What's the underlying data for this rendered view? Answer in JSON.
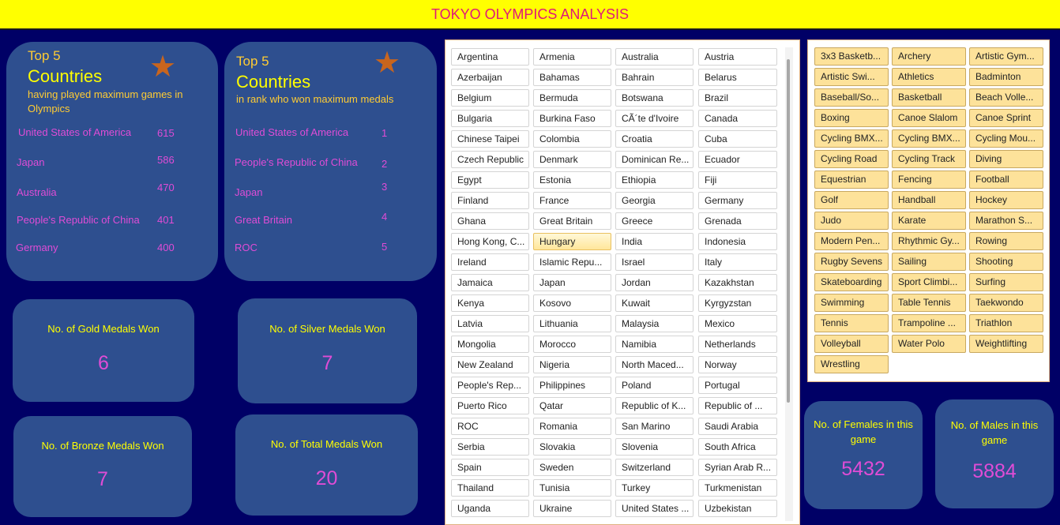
{
  "header": {
    "title": "TOKYO OLYMPICS ANALYSIS"
  },
  "colors": {
    "background": "#000066",
    "header": "#ffff00",
    "card": "#2e4f8f",
    "title_text": "#e0187a",
    "accent_pink": "#e04cd6",
    "accent_yellow": "#ffff00"
  },
  "games_card": {
    "top5": "Top 5",
    "title": "Countries",
    "subtitle": "having played maximum games in Olympics",
    "icon": "star-icon",
    "rows": [
      {
        "name": "United States of America",
        "value": "615"
      },
      {
        "name": "Japan",
        "value": "586"
      },
      {
        "name": "Australia",
        "value": "470"
      },
      {
        "name": "People's Republic of China",
        "value": "401"
      },
      {
        "name": "Germany",
        "value": "400"
      }
    ]
  },
  "medals_card": {
    "top5": "Top 5",
    "title": "Countries",
    "subtitle": "in rank who won maximum medals",
    "icon": "star-icon",
    "rows": [
      {
        "name": "United States of America",
        "value": "1"
      },
      {
        "name": "People's Republic of China",
        "value": "2"
      },
      {
        "name": "Japan",
        "value": "3"
      },
      {
        "name": "Great Britain",
        "value": "4"
      },
      {
        "name": "ROC",
        "value": "5"
      }
    ]
  },
  "stats": {
    "gold": {
      "label": "No. of  Gold Medals Won",
      "value": "6"
    },
    "silver": {
      "label": "No. of Silver Medals Won",
      "value": "7"
    },
    "bronze": {
      "label": "No. of Bronze Medals Won",
      "value": "7"
    },
    "total": {
      "label": "No. of Total Medals Won",
      "value": "20"
    },
    "females": {
      "label": "No. of Females in this game",
      "value": "5432"
    },
    "males": {
      "label": "No. of Males in this game",
      "value": "5884"
    }
  },
  "countries_slicer": {
    "selected": "Hungary",
    "items": [
      "Argentina",
      "Armenia",
      "Australia",
      "Austria",
      "Azerbaijan",
      "Bahamas",
      "Bahrain",
      "Belarus",
      "Belgium",
      "Bermuda",
      "Botswana",
      "Brazil",
      "Bulgaria",
      "Burkina Faso",
      "CÃ´te d'Ivoire",
      "Canada",
      "Chinese Taipei",
      "Colombia",
      "Croatia",
      "Cuba",
      "Czech Republic",
      "Denmark",
      "Dominican Re...",
      "Ecuador",
      "Egypt",
      "Estonia",
      "Ethiopia",
      "Fiji",
      "Finland",
      "France",
      "Georgia",
      "Germany",
      "Ghana",
      "Great Britain",
      "Greece",
      "Grenada",
      "Hong Kong, C...",
      "Hungary",
      "India",
      "Indonesia",
      "Ireland",
      "Islamic Repu...",
      "Israel",
      "Italy",
      "Jamaica",
      "Japan",
      "Jordan",
      "Kazakhstan",
      "Kenya",
      "Kosovo",
      "Kuwait",
      "Kyrgyzstan",
      "Latvia",
      "Lithuania",
      "Malaysia",
      "Mexico",
      "Mongolia",
      "Morocco",
      "Namibia",
      "Netherlands",
      "New Zealand",
      "Nigeria",
      "North Maced...",
      "Norway",
      "People's Rep...",
      "Philippines",
      "Poland",
      "Portugal",
      "Puerto Rico",
      "Qatar",
      "Republic of K...",
      "Republic of ...",
      "ROC",
      "Romania",
      "San Marino",
      "Saudi Arabia",
      "Serbia",
      "Slovakia",
      "Slovenia",
      "South Africa",
      "Spain",
      "Sweden",
      "Switzerland",
      "Syrian Arab R...",
      "Thailand",
      "Tunisia",
      "Turkey",
      "Turkmenistan",
      "Uganda",
      "Ukraine",
      "United States ...",
      "Uzbekistan"
    ]
  },
  "sports_slicer": {
    "items": [
      "3x3 Basketb...",
      "Archery",
      "Artistic Gym...",
      "Artistic Swi...",
      "Athletics",
      "Badminton",
      "Baseball/So...",
      "Basketball",
      "Beach Volle...",
      "Boxing",
      "Canoe Slalom",
      "Canoe Sprint",
      "Cycling BMX...",
      "Cycling BMX...",
      "Cycling Mou...",
      "Cycling Road",
      "Cycling Track",
      "Diving",
      "Equestrian",
      "Fencing",
      "Football",
      "Golf",
      "Handball",
      "Hockey",
      "Judo",
      "Karate",
      "Marathon S...",
      "Modern Pen...",
      "Rhythmic Gy...",
      "Rowing",
      "Rugby Sevens",
      "Sailing",
      "Shooting",
      "Skateboarding",
      "Sport Climbi...",
      "Surfing",
      "Swimming",
      "Table Tennis",
      "Taekwondo",
      "Tennis",
      "Trampoline ...",
      "Triathlon",
      "Volleyball",
      "Water Polo",
      "Weightlifting",
      "Wrestling"
    ]
  }
}
